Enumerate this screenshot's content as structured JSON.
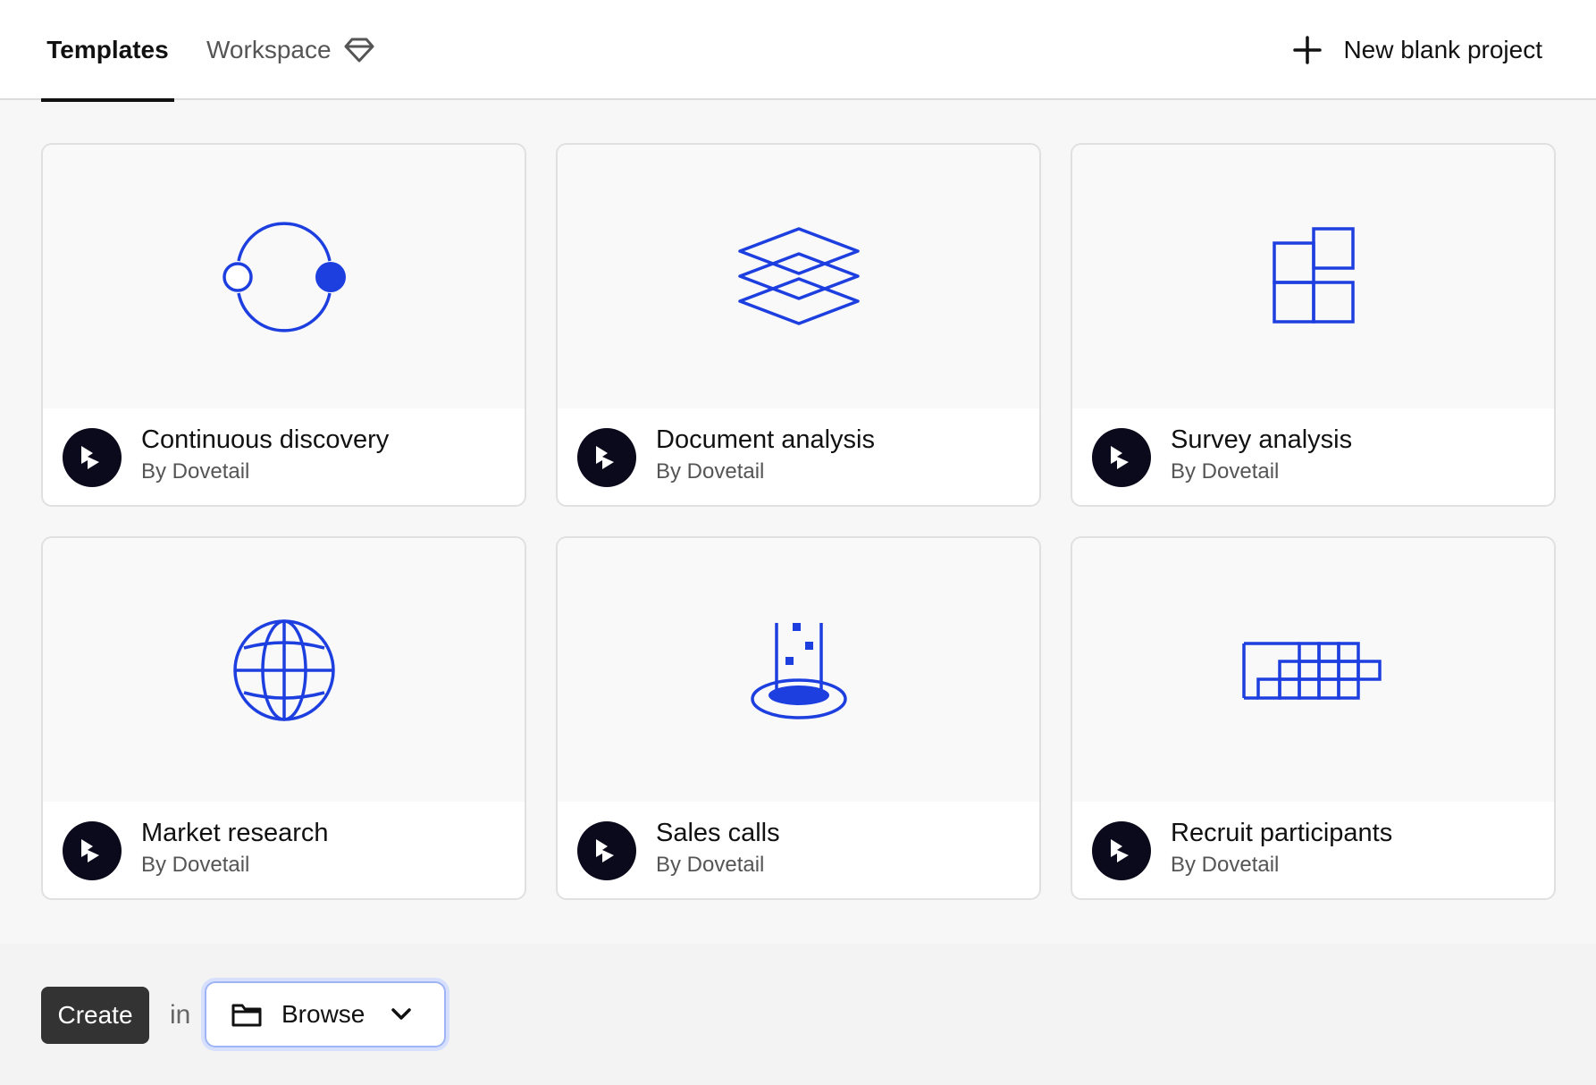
{
  "header": {
    "tabs": [
      {
        "label": "Templates",
        "active": true
      },
      {
        "label": "Workspace",
        "active": false,
        "icon": "gem-icon"
      }
    ],
    "new_project_label": "New blank project"
  },
  "templates": [
    {
      "title": "Continuous discovery",
      "author": "By Dovetail",
      "icon": "discovery-loop-icon"
    },
    {
      "title": "Document analysis",
      "author": "By Dovetail",
      "icon": "layers-icon"
    },
    {
      "title": "Survey analysis",
      "author": "By Dovetail",
      "icon": "blocks-icon"
    },
    {
      "title": "Market research",
      "author": "By Dovetail",
      "icon": "globe-icon"
    },
    {
      "title": "Sales calls",
      "author": "By Dovetail",
      "icon": "beaker-icon"
    },
    {
      "title": "Recruit participants",
      "author": "By Dovetail",
      "icon": "staircase-grid-icon"
    }
  ],
  "footer": {
    "create_label": "Create",
    "in_label": "in",
    "location_label": "Browse"
  },
  "colors": {
    "accent": "#1d3fe0",
    "avatar_bg": "#0b0a1c",
    "create_bg": "#333333"
  }
}
